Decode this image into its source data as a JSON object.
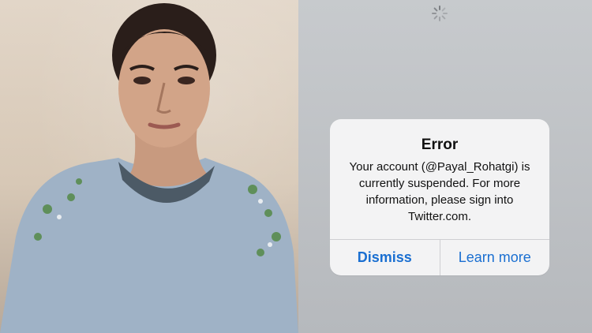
{
  "alert": {
    "title": "Error",
    "message": "Your account (@Payal_Rohatgi) is currently suspended. For more information, please sign into Twitter.com.",
    "buttons": {
      "dismiss": "Dismiss",
      "learn_more": "Learn more"
    }
  },
  "icons": {
    "spinner": "loading-spinner-icon"
  },
  "colors": {
    "button_text": "#1a6fd1",
    "alert_bg": "#f3f3f4",
    "screen_bg": "#b9bcc0"
  }
}
